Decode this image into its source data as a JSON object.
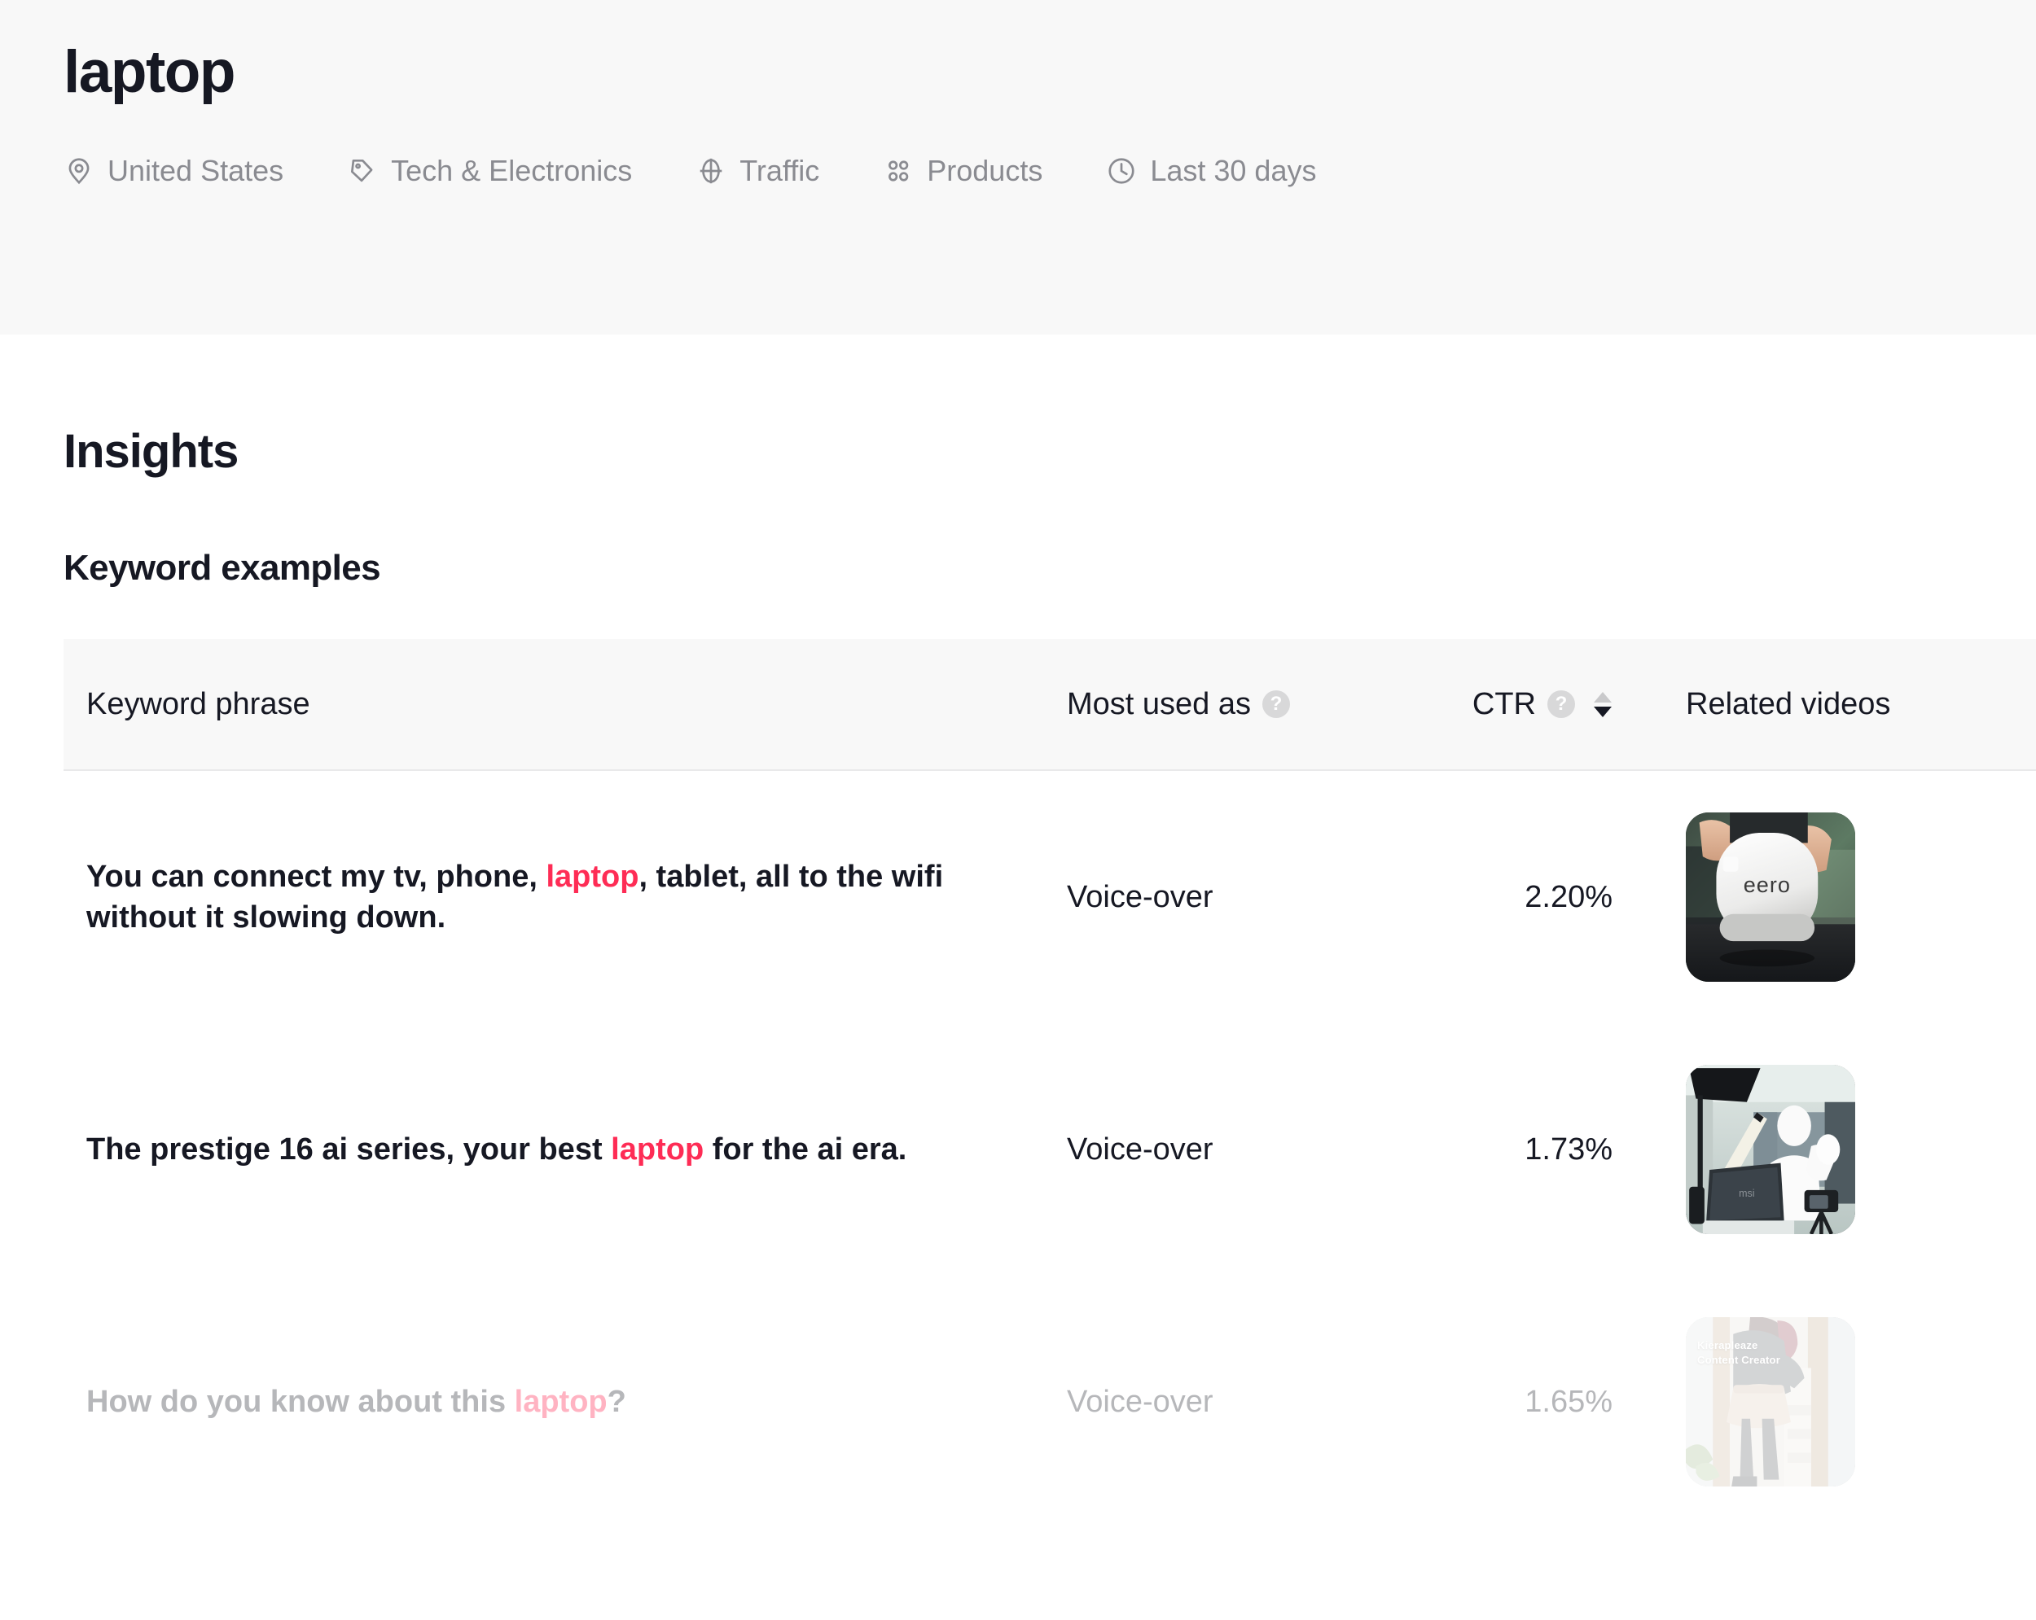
{
  "header": {
    "title": "laptop",
    "meta": [
      {
        "icon": "location-pin-icon",
        "label": "United States"
      },
      {
        "icon": "tag-icon",
        "label": "Tech & Electronics"
      },
      {
        "icon": "target-icon",
        "label": "Traffic"
      },
      {
        "icon": "products-grid-icon",
        "label": "Products"
      },
      {
        "icon": "clock-icon",
        "label": "Last 30 days"
      }
    ]
  },
  "main": {
    "page_heading": "Insights",
    "section_heading": "Keyword examples"
  },
  "table": {
    "columns": {
      "phrase": "Keyword phrase",
      "used_as": "Most used as",
      "ctr": "CTR",
      "videos": "Related videos"
    },
    "help_glyph": "?",
    "sort": {
      "active_direction": "desc"
    },
    "rows": [
      {
        "phrase_before": "You can connect my tv, phone, ",
        "phrase_highlight": "laptop",
        "phrase_after": ", tablet, all to the wifi without it slowing down.",
        "used_as": "Voice-over",
        "ctr": "2.20%",
        "thumbnail": "hand-holding-eero-router",
        "thumbnail_caption": ""
      },
      {
        "phrase_before": "The prestige 16 ai series, your best ",
        "phrase_highlight": "laptop",
        "phrase_after": " for the ai era.",
        "used_as": "Voice-over",
        "ctr": "1.73%",
        "thumbnail": "studio-creator-with-msi-laptop",
        "thumbnail_caption": ""
      },
      {
        "phrase_before": "How do you know about this ",
        "phrase_highlight": "laptop",
        "phrase_after": "?",
        "used_as": "Voice-over",
        "ctr": "1.65%",
        "thumbnail": "creator-in-doorway",
        "thumbnail_caption": "Kierapleaze\nContent Creator"
      }
    ]
  },
  "colors": {
    "accent": "#fe2c55",
    "accent_faded": "#ffb3c2",
    "text": "#161823",
    "muted": "#8a8b91",
    "header_bg": "#f8f8f8"
  }
}
